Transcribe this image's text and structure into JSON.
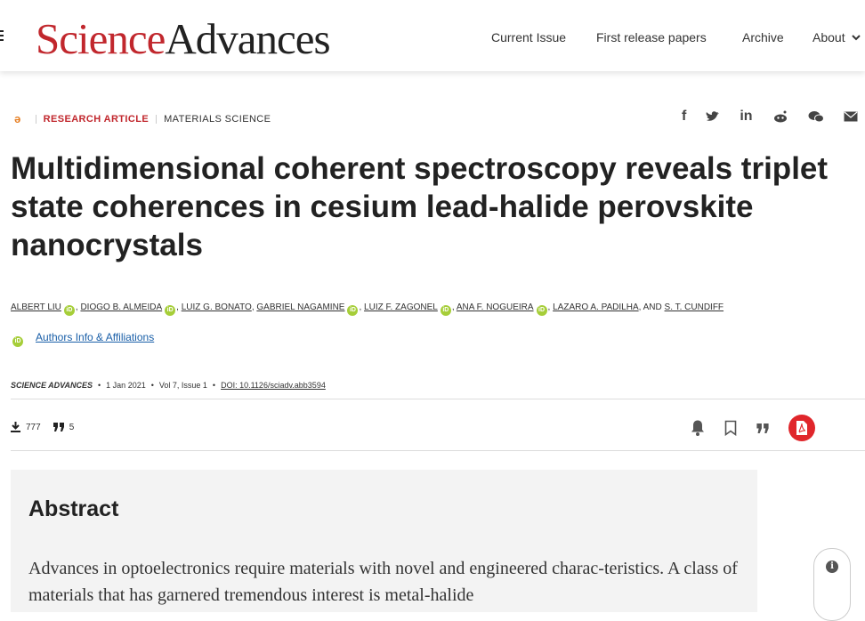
{
  "header": {
    "logo_science": "Science",
    "logo_advances": "Advances",
    "nav": [
      "Current Issue",
      "First release papers",
      "Archive",
      "About"
    ]
  },
  "article": {
    "type": "RESEARCH ARTICLE",
    "subject": "MATERIALS SCIENCE",
    "title": "Multidimensional coherent spectroscopy reveals triplet state coherences in cesium lead-halide perovskite nanocrystals",
    "authors": [
      "ALBERT LIU",
      "DIOGO B. ALMEIDA",
      "LUIZ G. BONATO",
      "GABRIEL NAGAMINE",
      "LUIZ F. ZAGONEL",
      "ANA F. NOGUEIRA",
      "LAZARO A. PADILHA",
      "S. T. CUNDIFF"
    ],
    "and_text": "AND",
    "authors_info_link": "Authors Info & Affiliations",
    "journal": "SCIENCE ADVANCES",
    "date": "1 Jan 2021",
    "volume": "Vol 7, Issue 1",
    "doi": "DOI: 10.1126/sciadv.abb3594",
    "downloads": "777",
    "citations": "5"
  },
  "share_icons": [
    "facebook-icon",
    "twitter-icon",
    "linkedin-icon",
    "reddit-icon",
    "wechat-icon",
    "email-icon"
  ],
  "abstract": {
    "heading": "Abstract",
    "text": "Advances in optoelectronics require materials with novel and engineered charac-teristics. A class of materials that has garnered tremendous interest is metal-halide"
  },
  "colors": {
    "brand_red": "#c1272d",
    "orcid_green": "#a6ce39",
    "link_blue": "#1a5fa8",
    "pdf_red": "#e0262b"
  }
}
